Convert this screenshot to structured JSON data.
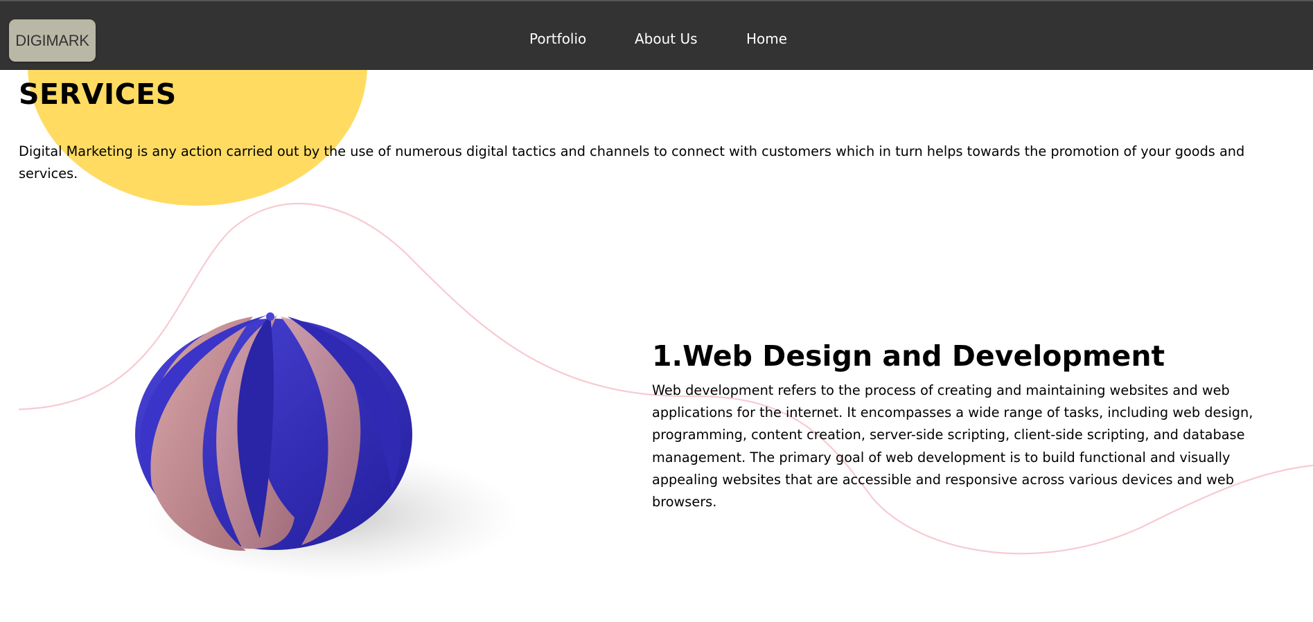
{
  "header": {
    "logo_text": "DIGIMARK",
    "nav": [
      {
        "label": "Portfolio"
      },
      {
        "label": "About Us"
      },
      {
        "label": "Home"
      }
    ]
  },
  "services": {
    "title": "SERVICES",
    "description": "Digital Marketing is any action carried out by the use of numerous digital tactics and channels to connect with customers which in turn helps towards the promotion of your goods and services."
  },
  "service_card": {
    "title": "1.Web Design and Development",
    "description": "Web development refers to the process of creating and maintaining websites and web applications for the internet. It encompasses a wide range of tasks, including web design, programming, content creation, server-side scripting, client-side scripting, and database management. The primary goal of web development is to build functional and visually appealing websites that are accessible and responsive across various devices and web browsers.",
    "image_icon": "twisted-sphere-illustration"
  },
  "colors": {
    "navbar": "#333333",
    "logo_bg": "#b9b8a6",
    "accent_circle": "#ffdb62",
    "wave_line": "#f6c4cc",
    "sphere_blue": "#3b35c4",
    "sphere_pink": "#c98f96"
  }
}
